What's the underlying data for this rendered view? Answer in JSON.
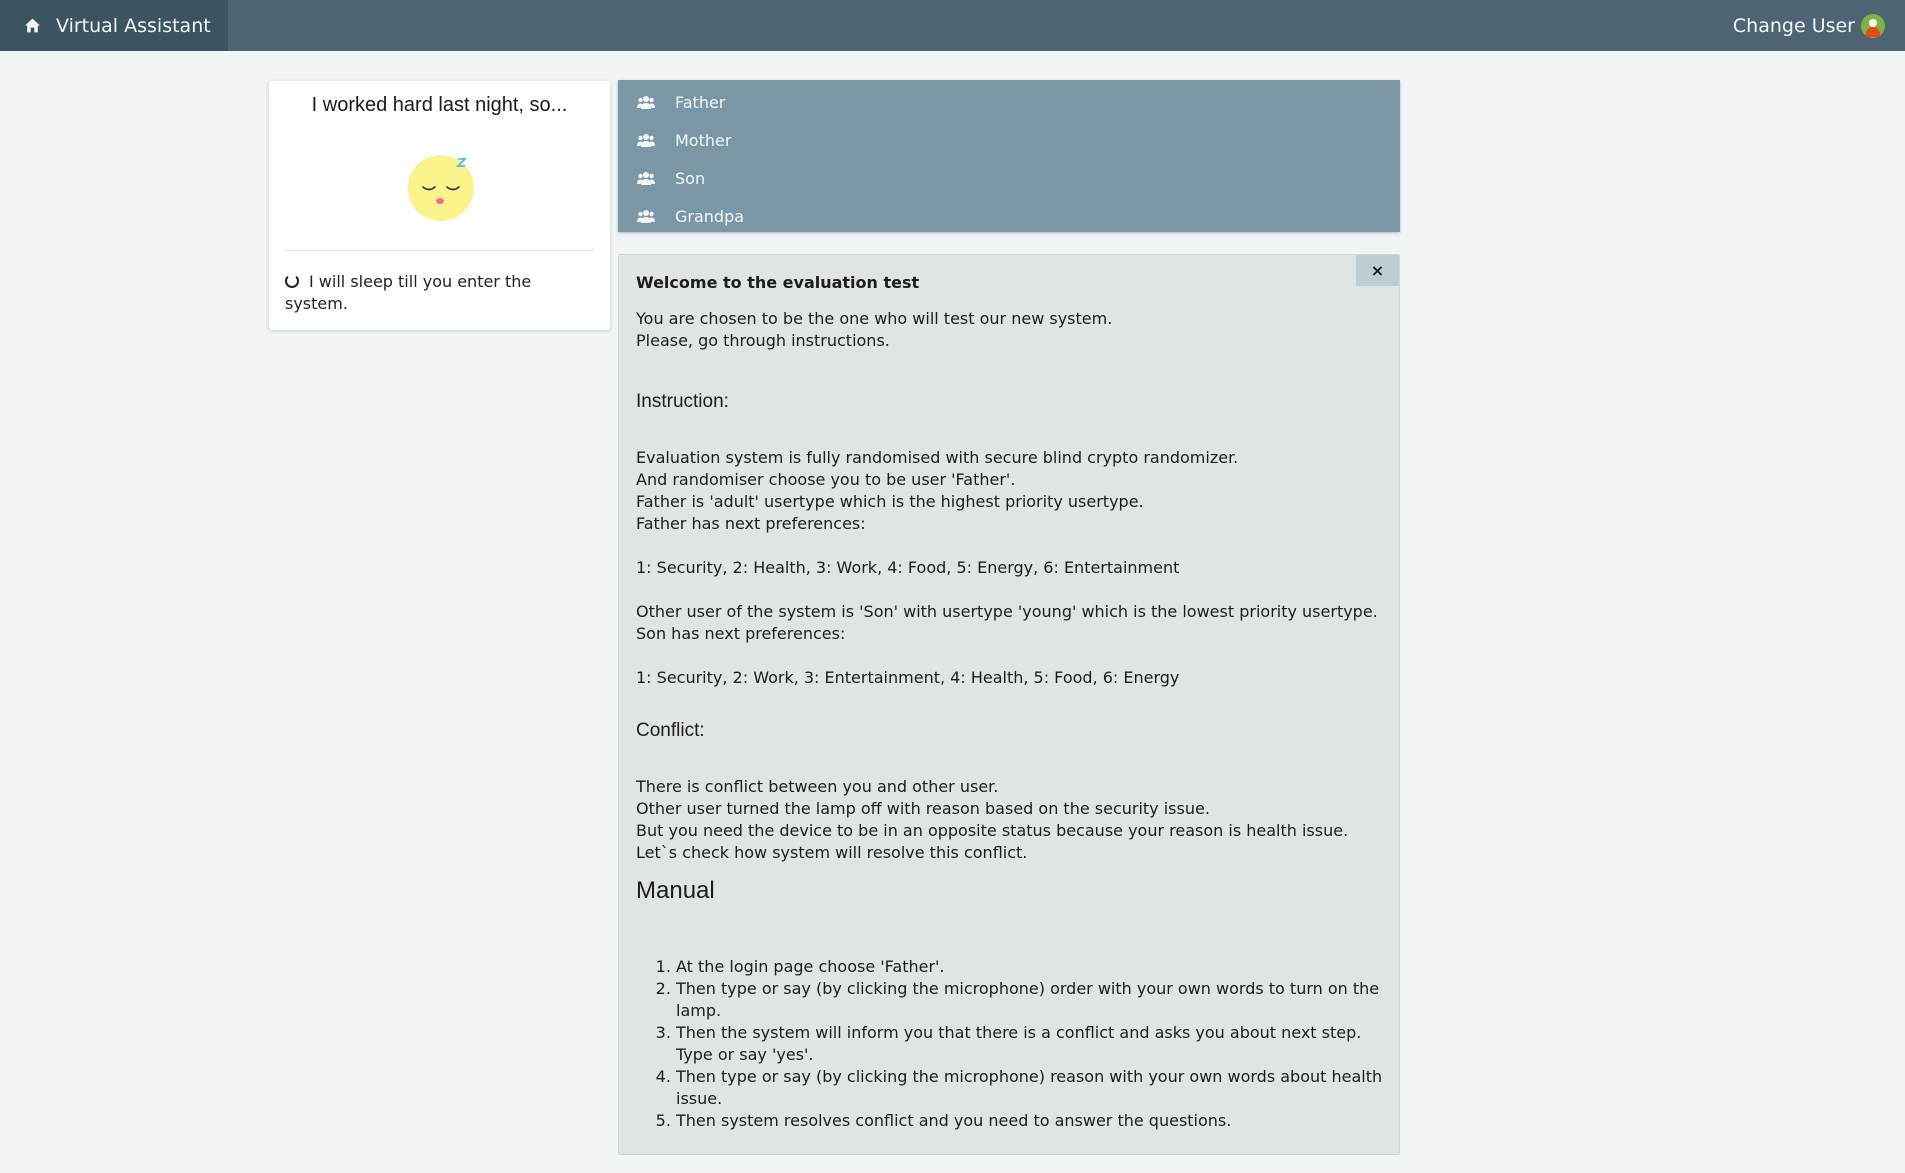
{
  "navbar": {
    "brand": "Virtual Assistant",
    "change_user": "Change User"
  },
  "assistant_card": {
    "title": "I worked hard last night, so...",
    "status": "I will sleep till you enter the system.",
    "face_icon": "sleepy-face-icon"
  },
  "users": [
    {
      "label": "Father"
    },
    {
      "label": "Mother"
    },
    {
      "label": "Son"
    },
    {
      "label": "Grandpa"
    }
  ],
  "panel": {
    "close": "×",
    "title": "Welcome to the evaluation test",
    "intro": [
      "You are chosen to be the one who will test our new system.",
      "Please, go through instructions."
    ],
    "instruction_heading": "Instruction:",
    "instruction_lines": [
      "Evaluation system is fully randomised with secure blind crypto randomizer.",
      "And randomiser choose you to be user 'Father'.",
      "Father is 'adult' usertype which is the highest priority usertype.",
      "Father has next preferences:"
    ],
    "father_prefs": "1: Security, 2: Health, 3: Work, 4: Food, 5: Energy, 6: Entertainment",
    "other_user_lines": [
      "Other user of the system is 'Son' with usertype 'young' which is the lowest priority usertype.",
      "Son has next preferences:"
    ],
    "son_prefs": "1: Security, 2: Work, 3: Entertainment, 4: Health, 5: Food, 6: Energy",
    "conflict_heading": "Conflict:",
    "conflict_lines": [
      "There is conflict between you and other user.",
      "Other user turned the lamp off with reason based on the security issue.",
      "But you need the device to be in an opposite status because your reason is health issue.",
      "Let`s check how system will resolve this conflict."
    ],
    "manual_heading": "Manual",
    "manual_steps": [
      "At the login page choose 'Father'.",
      "Then type or say (by clicking the microphone) order with your own words to turn on the lamp.",
      "Then the system will inform you that there is a conflict and asks you about next step. Type or say 'yes'.",
      "Then type or say (by clicking the microphone) reason with your own words about health issue.",
      "Then system resolves conflict and you need to answer the questions."
    ]
  },
  "colors": {
    "navbar": "#4e6472",
    "brand_bg": "#3e5360",
    "user_menu": "#7b97a5",
    "panel_bg": "#dfe4e7",
    "page_bg": "#f1f5f5"
  }
}
